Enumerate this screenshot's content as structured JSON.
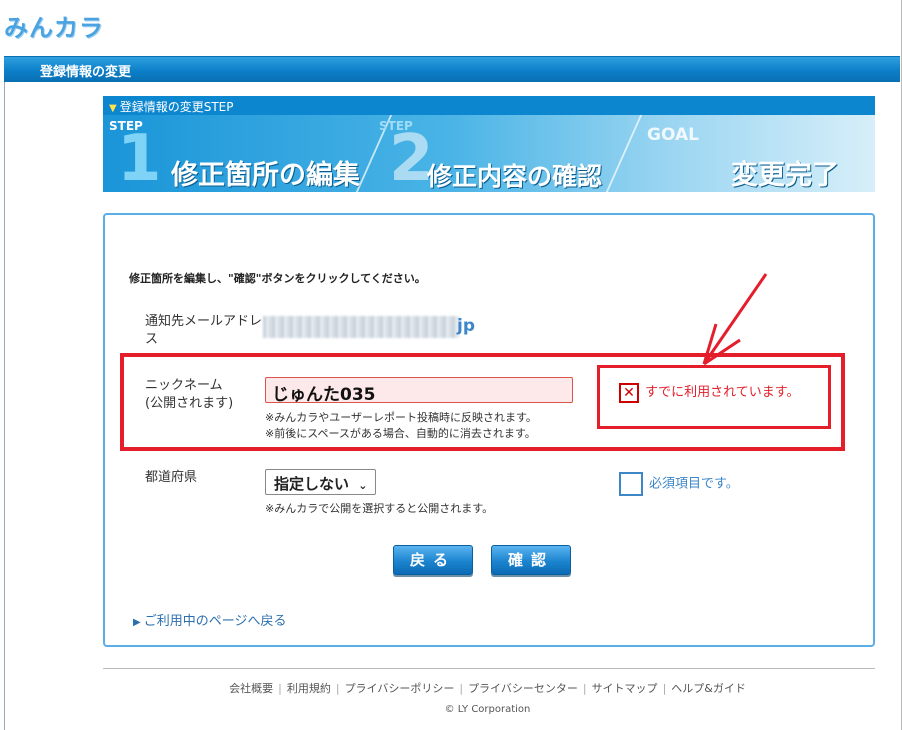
{
  "header": {
    "logo": "みんカラ"
  },
  "titlebar": {
    "title": "登録情報の変更"
  },
  "steps": {
    "heading": "登録情報の変更STEP",
    "step1": {
      "tag": "STEP",
      "num": "1",
      "label": "修正箇所の編集"
    },
    "step2": {
      "tag": "STEP",
      "num": "2",
      "label": "修正内容の確認"
    },
    "goal": {
      "tag": "GOAL",
      "label": "変更完了"
    }
  },
  "form": {
    "instruction": "修正箇所を編集し、\"確認\"ボタンをクリックしてください。",
    "email": {
      "label_line1": "通知先メールアドレ",
      "label_line2": "ス",
      "value_suffix": "jp"
    },
    "nickname": {
      "label_line1": "ニックネーム",
      "label_line2": "(公開されます)",
      "value": "じゅんた035",
      "note1": "※みんカラやユーザーレポート投稿時に反映されます。",
      "note2": "※前後にスペースがある場合、自動的に消去されます。",
      "error_icon": "x-error-icon",
      "error": "すでに利用されています。"
    },
    "prefecture": {
      "label": "都道府県",
      "selected": "指定しない",
      "note": "※みんカラで公開を選択すると公開されます。",
      "required": "必須項目です。"
    },
    "buttons": {
      "back": "戻る",
      "confirm": "確認"
    },
    "back_link": "ご利用中のページへ戻る"
  },
  "footer": {
    "links": [
      "会社概要",
      "利用規約",
      "プライバシーポリシー",
      "プライバシーセンター",
      "サイトマップ",
      "ヘルプ&ガイド"
    ],
    "copyright": "© LY Corporation"
  },
  "colors": {
    "accent": "#0d86d0",
    "error": "#e41e2b",
    "link": "#2c6fad"
  }
}
